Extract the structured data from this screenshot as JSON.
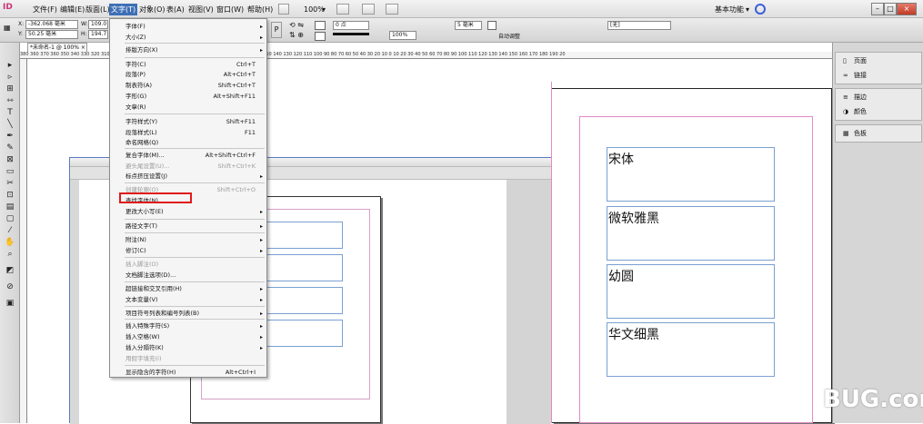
{
  "menubar": {
    "logo": "ID",
    "items": [
      "文件(F)",
      "编辑(E)",
      "版面(L)",
      "文字(T)",
      "对象(O)",
      "表(A)",
      "视图(V)",
      "窗口(W)",
      "帮助(H)"
    ],
    "zoom": "100%",
    "workspace": "基本功能"
  },
  "controlbar": {
    "x_label": "X:",
    "x_value": "-362.068 毫米",
    "y_label": "Y:",
    "y_value": "50.25 毫米",
    "w_label": "W:",
    "w_value": "109.0",
    "h_label": "H:",
    "h_value": "194.7",
    "stroke_value": "0 点",
    "opacity_value": "100%",
    "size_value": "5 毫米",
    "autofit_label": "自动调整",
    "none_label": "[无]"
  },
  "document_tab": "*未命名-1 @ 100% ×",
  "ruler_marks": "380 360 370 360 350 340 330 320 310 300 290 280 270 260 250 240 230 220 210 200 190 180 170 160 150 140 130 120 110 100 90 80 70 60 50 40 30 20 10 0 10 20 30 40 50 60 70 80 90 100 110 120 130 140 150 160 170 180 190 20",
  "text_menu": {
    "items": [
      {
        "label": "字体(F)",
        "shortcut": "",
        "submenu": true,
        "disabled": false
      },
      {
        "label": "大小(Z)",
        "shortcut": "",
        "submenu": true,
        "disabled": false
      },
      {
        "label": "排版方向(X)",
        "shortcut": "",
        "submenu": true,
        "disabled": false
      },
      {
        "label": "字符(C)",
        "shortcut": "Ctrl+T",
        "submenu": false,
        "disabled": false
      },
      {
        "label": "段落(P)",
        "shortcut": "Alt+Ctrl+T",
        "submenu": false,
        "disabled": false
      },
      {
        "label": "制表符(A)",
        "shortcut": "Shift+Ctrl+T",
        "submenu": false,
        "disabled": false
      },
      {
        "label": "字形(G)",
        "shortcut": "Alt+Shift+F11",
        "submenu": false,
        "disabled": false
      },
      {
        "label": "文章(R)",
        "shortcut": "",
        "submenu": false,
        "disabled": false
      },
      {
        "label": "字符样式(Y)",
        "shortcut": "Shift+F11",
        "submenu": false,
        "disabled": false
      },
      {
        "label": "段落样式(L)",
        "shortcut": "F11",
        "submenu": false,
        "disabled": false
      },
      {
        "label": "命名网格(Q)",
        "shortcut": "",
        "submenu": false,
        "disabled": false
      },
      {
        "label": "复合字体(M)...",
        "shortcut": "Alt+Shift+Ctrl+F",
        "submenu": false,
        "disabled": false
      },
      {
        "label": "避头尾设置(U)...",
        "shortcut": "Shift+Ctrl+K",
        "submenu": false,
        "disabled": true
      },
      {
        "label": "标点挤压设置(J)",
        "shortcut": "",
        "submenu": true,
        "disabled": false
      },
      {
        "label": "创建轮廓(O)",
        "shortcut": "Shift+Ctrl+O",
        "submenu": false,
        "disabled": true
      },
      {
        "label": "查找字体(N)...",
        "shortcut": "",
        "submenu": false,
        "disabled": false
      },
      {
        "label": "更改大小写(E)",
        "shortcut": "",
        "submenu": true,
        "disabled": false
      },
      {
        "label": "路径文字(T)",
        "shortcut": "",
        "submenu": true,
        "disabled": false
      },
      {
        "label": "附注(N)",
        "shortcut": "",
        "submenu": true,
        "disabled": false
      },
      {
        "label": "修订(C)",
        "shortcut": "",
        "submenu": true,
        "disabled": false
      },
      {
        "label": "插入脚注(O)",
        "shortcut": "",
        "submenu": false,
        "disabled": true
      },
      {
        "label": "文档脚注选项(D)...",
        "shortcut": "",
        "submenu": false,
        "disabled": false
      },
      {
        "label": "超链接和交叉引用(H)",
        "shortcut": "",
        "submenu": true,
        "disabled": false
      },
      {
        "label": "文本变量(V)",
        "shortcut": "",
        "submenu": true,
        "disabled": false
      },
      {
        "label": "项目符号列表和编号列表(B)",
        "shortcut": "",
        "submenu": true,
        "disabled": false
      },
      {
        "label": "插入特殊字符(S)",
        "shortcut": "",
        "submenu": true,
        "disabled": false
      },
      {
        "label": "插入空格(W)",
        "shortcut": "",
        "submenu": true,
        "disabled": false
      },
      {
        "label": "插入分隔符(K)",
        "shortcut": "",
        "submenu": true,
        "disabled": false
      },
      {
        "label": "用假字填充(I)",
        "shortcut": "",
        "submenu": false,
        "disabled": true
      },
      {
        "label": "显示隐含的字符(H)",
        "shortcut": "Alt+Ctrl+I",
        "submenu": false,
        "disabled": false
      }
    ]
  },
  "right_panel": {
    "group1": [
      "页面",
      "链接"
    ],
    "group2": [
      "描边",
      "颜色"
    ],
    "group3": [
      "色板"
    ]
  },
  "frames": [
    "宋体",
    "微软雅黑",
    "幼圆",
    "华文细黑"
  ],
  "inner_frame_text": "黑",
  "watermark": "BUG.com"
}
